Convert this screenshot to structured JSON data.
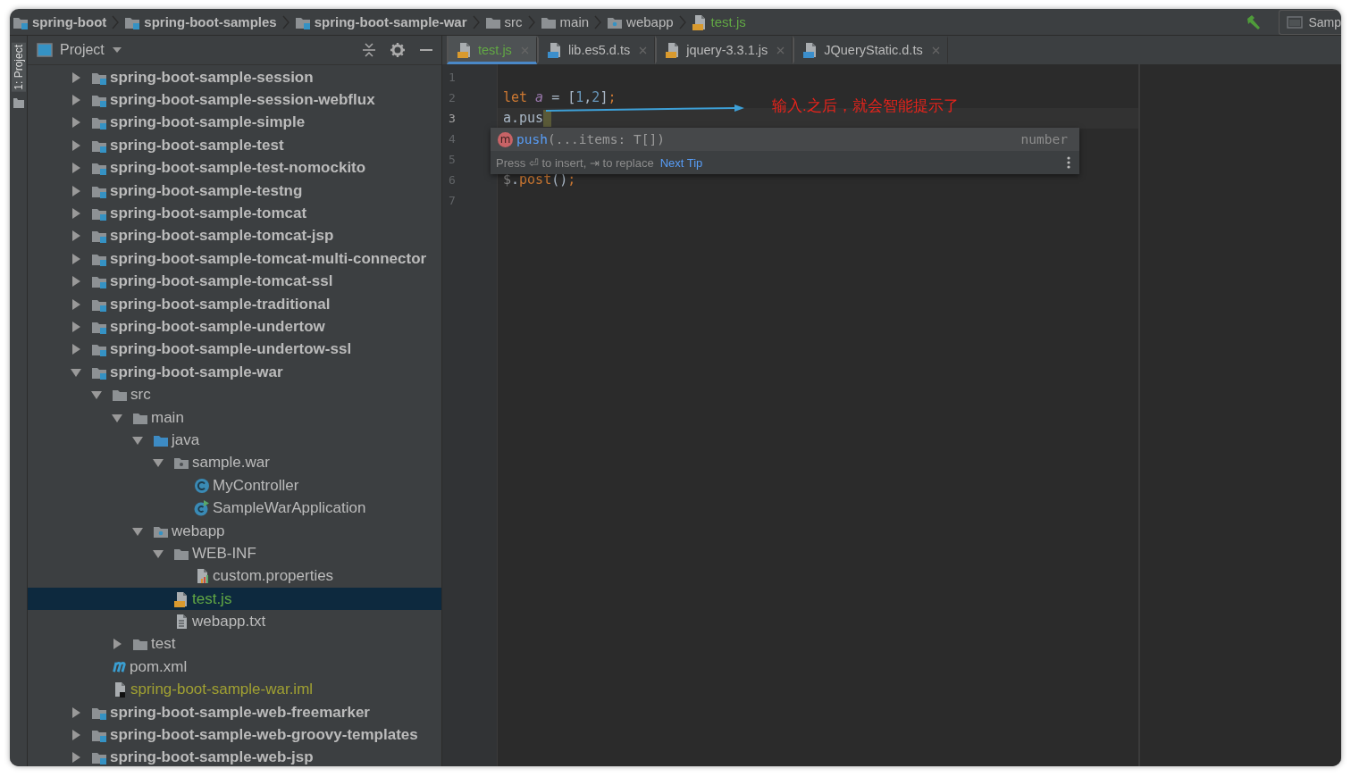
{
  "breadcrumbs": [
    {
      "label": "spring-boot",
      "kind": "module"
    },
    {
      "label": "spring-boot-samples",
      "kind": "module"
    },
    {
      "label": "spring-boot-sample-war",
      "kind": "module"
    },
    {
      "label": "src",
      "kind": "folder"
    },
    {
      "label": "main",
      "kind": "folder"
    },
    {
      "label": "webapp",
      "kind": "web"
    },
    {
      "label": "test.js",
      "kind": "js",
      "color": "#62a844"
    }
  ],
  "run_config": {
    "label": "Samp"
  },
  "side_strip": {
    "label": "1: Project"
  },
  "project_panel": {
    "title": "Project",
    "tree": [
      {
        "label": "spring-boot-sample-session",
        "kind": "module",
        "expanded": false,
        "selected": false
      },
      {
        "label": "spring-boot-sample-session-webflux",
        "kind": "module",
        "expanded": false,
        "selected": false
      },
      {
        "label": "spring-boot-sample-simple",
        "kind": "module",
        "expanded": false,
        "selected": false
      },
      {
        "label": "spring-boot-sample-test",
        "kind": "module",
        "expanded": false,
        "selected": false
      },
      {
        "label": "spring-boot-sample-test-nomockito",
        "kind": "module",
        "expanded": false,
        "selected": false
      },
      {
        "label": "spring-boot-sample-testng",
        "kind": "module",
        "expanded": false,
        "selected": false
      },
      {
        "label": "spring-boot-sample-tomcat",
        "kind": "module",
        "expanded": false,
        "selected": false
      },
      {
        "label": "spring-boot-sample-tomcat-jsp",
        "kind": "module",
        "expanded": false,
        "selected": false
      },
      {
        "label": "spring-boot-sample-tomcat-multi-connector",
        "kind": "module",
        "expanded": false,
        "selected": false
      },
      {
        "label": "spring-boot-sample-tomcat-ssl",
        "kind": "module",
        "expanded": false,
        "selected": false
      },
      {
        "label": "spring-boot-sample-traditional",
        "kind": "module",
        "expanded": false,
        "selected": false
      },
      {
        "label": "spring-boot-sample-undertow",
        "kind": "module",
        "expanded": false,
        "selected": false
      },
      {
        "label": "spring-boot-sample-undertow-ssl",
        "kind": "module",
        "expanded": false,
        "selected": false
      },
      {
        "label": "spring-boot-sample-war",
        "kind": "module",
        "expanded": true,
        "selected": false,
        "children": [
          {
            "label": "src",
            "kind": "folder",
            "expanded": true,
            "selected": false,
            "children": [
              {
                "label": "main",
                "kind": "folder",
                "expanded": true,
                "selected": false,
                "children": [
                  {
                    "label": "java",
                    "kind": "source",
                    "expanded": true,
                    "selected": false,
                    "children": [
                      {
                        "label": "sample.war",
                        "kind": "package",
                        "expanded": true,
                        "selected": false,
                        "children": [
                          {
                            "label": "MyController",
                            "kind": "class",
                            "selected": false
                          },
                          {
                            "label": "SampleWarApplication",
                            "kind": "app",
                            "selected": false
                          }
                        ]
                      }
                    ]
                  },
                  {
                    "label": "webapp",
                    "kind": "web",
                    "expanded": true,
                    "selected": false,
                    "children": [
                      {
                        "label": "WEB-INF",
                        "kind": "folder",
                        "expanded": true,
                        "selected": false,
                        "children": [
                          {
                            "label": "custom.properties",
                            "kind": "properties",
                            "selected": false
                          }
                        ]
                      },
                      {
                        "label": "test.js",
                        "kind": "js",
                        "selected": true,
                        "color": "#62a844"
                      },
                      {
                        "label": "webapp.txt",
                        "kind": "text",
                        "selected": false
                      }
                    ]
                  }
                ]
              },
              {
                "label": "test",
                "kind": "folder",
                "expanded": false,
                "selected": false
              }
            ]
          },
          {
            "label": "pom.xml",
            "kind": "maven",
            "selected": false
          },
          {
            "label": "spring-boot-sample-war.iml",
            "kind": "iml",
            "selected": false,
            "color": "#a0a032"
          }
        ]
      },
      {
        "label": "spring-boot-sample-web-freemarker",
        "kind": "module",
        "expanded": false,
        "selected": false
      },
      {
        "label": "spring-boot-sample-web-groovy-templates",
        "kind": "module",
        "expanded": false,
        "selected": false
      },
      {
        "label": "spring-boot-sample-web-jsp",
        "kind": "module",
        "expanded": false,
        "selected": false
      }
    ]
  },
  "tabs": [
    {
      "label": "test.js",
      "kind": "js",
      "selected": true
    },
    {
      "label": "lib.es5.d.ts",
      "kind": "ts",
      "selected": false
    },
    {
      "label": "jquery-3.3.1.js",
      "kind": "js",
      "selected": false
    },
    {
      "label": "JQueryStatic.d.ts",
      "kind": "ts",
      "selected": false
    }
  ],
  "editor": {
    "lines": [
      {
        "number": "1",
        "current": false
      },
      {
        "number": "2",
        "current": false,
        "tokens": [
          {
            "text": "let",
            "kind": "keyword"
          },
          {
            "text": " a",
            "kind": "variable"
          },
          {
            "text": " = [",
            "kind": "plain"
          },
          {
            "text": "1",
            "kind": "number"
          },
          {
            "text": ",",
            "kind": "plain"
          },
          {
            "text": "2",
            "kind": "number"
          },
          {
            "text": "]",
            "kind": "plain"
          },
          {
            "text": ";",
            "kind": "keyword"
          }
        ]
      },
      {
        "number": "3",
        "current": true,
        "tokens": [
          {
            "text": "a.pus",
            "kind": "plain"
          }
        ]
      },
      {
        "number": "4",
        "current": false
      },
      {
        "number": "5",
        "current": false
      },
      {
        "number": "6",
        "current": false,
        "tokens": [
          {
            "text": "$",
            "kind": "dim"
          },
          {
            "text": ".",
            "kind": "plain"
          },
          {
            "text": "post",
            "kind": "keyword"
          },
          {
            "text": "()",
            "kind": "plain"
          },
          {
            "text": ";",
            "kind": "keyword"
          }
        ]
      },
      {
        "number": "7",
        "current": false
      }
    ],
    "completion": {
      "badge": "m",
      "name": "push",
      "signature": "(...items: T[])",
      "type": "number",
      "hint": "Press ⏎ to insert, ⇥ to replace",
      "link": "Next Tip"
    },
    "annotation": {
      "text": "输入.之后，就会智能提示了"
    }
  }
}
